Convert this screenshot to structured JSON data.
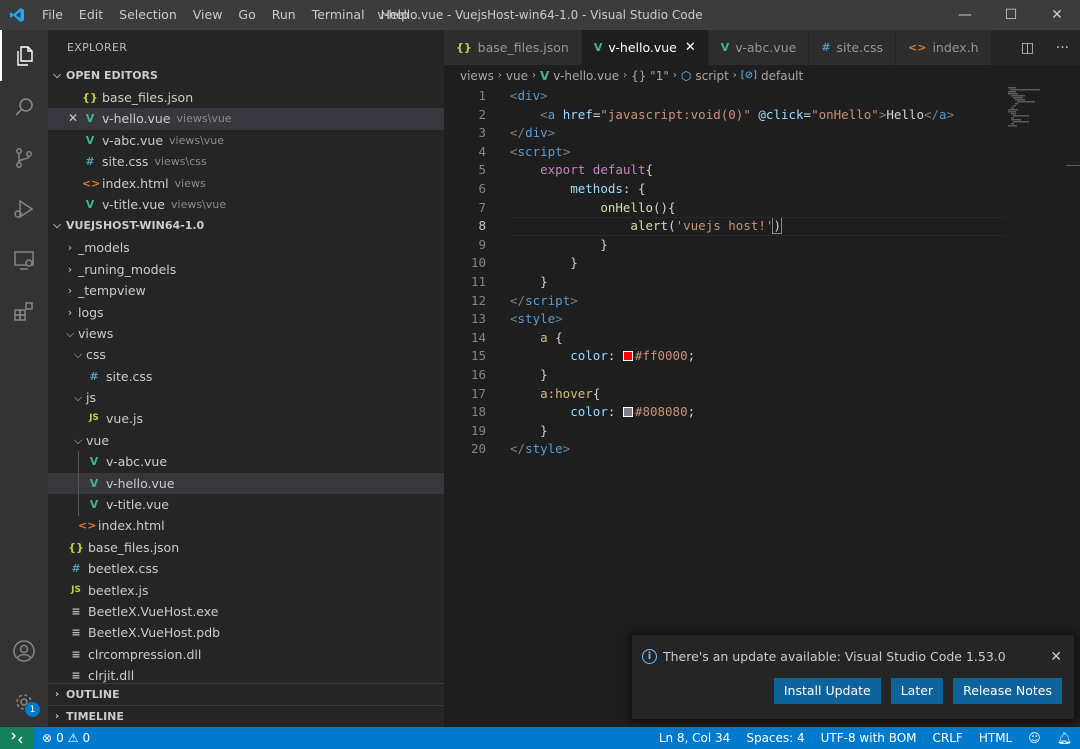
{
  "window": {
    "title": "v-hello.vue - VuejsHost-win64-1.0 - Visual Studio Code",
    "menu": [
      "File",
      "Edit",
      "Selection",
      "View",
      "Go",
      "Run",
      "Terminal",
      "Help"
    ],
    "controls": {
      "minimize": "—",
      "maximize": "☐",
      "close": "✕"
    }
  },
  "activity_bar": {
    "items": [
      "files-icon",
      "search-icon",
      "source-control-icon",
      "run-debug-icon",
      "remote-explorer-icon",
      "extensions-icon"
    ],
    "bottom": [
      "account-icon",
      "manage-gear-icon"
    ],
    "manage_badge": "1"
  },
  "sidebar": {
    "header": "EXPLORER",
    "open_editors": {
      "title": "OPEN EDITORS",
      "items": [
        {
          "icon": "{}",
          "kind": "json",
          "name": "base_files.json",
          "desc": ""
        },
        {
          "icon": "V",
          "kind": "vue",
          "name": "v-hello.vue",
          "desc": "views\\vue",
          "selected": true
        },
        {
          "icon": "V",
          "kind": "vue",
          "name": "v-abc.vue",
          "desc": "views\\vue"
        },
        {
          "icon": "#",
          "kind": "css",
          "name": "site.css",
          "desc": "views\\css"
        },
        {
          "icon": "<>",
          "kind": "html",
          "name": "index.html",
          "desc": "views"
        },
        {
          "icon": "V",
          "kind": "vue",
          "name": "v-title.vue",
          "desc": "views\\vue"
        }
      ]
    },
    "project": {
      "title": "VUEJSHOST-WIN64-1.0",
      "tree": [
        {
          "depth": 0,
          "type": "folder",
          "open": false,
          "name": "_models"
        },
        {
          "depth": 0,
          "type": "folder",
          "open": false,
          "name": "_runing_models"
        },
        {
          "depth": 0,
          "type": "folder",
          "open": false,
          "name": "_tempview"
        },
        {
          "depth": 0,
          "type": "folder",
          "open": false,
          "name": "logs"
        },
        {
          "depth": 0,
          "type": "folder",
          "open": true,
          "name": "views"
        },
        {
          "depth": 1,
          "type": "folder",
          "open": true,
          "name": "css"
        },
        {
          "depth": 2,
          "type": "file",
          "icon": "#",
          "kind": "css",
          "name": "site.css"
        },
        {
          "depth": 1,
          "type": "folder",
          "open": true,
          "name": "js"
        },
        {
          "depth": 2,
          "type": "file",
          "icon": "JS",
          "kind": "js",
          "name": "vue.js"
        },
        {
          "depth": 1,
          "type": "folder",
          "open": true,
          "name": "vue"
        },
        {
          "depth": 2,
          "type": "file",
          "icon": "V",
          "kind": "vue",
          "name": "v-abc.vue"
        },
        {
          "depth": 2,
          "type": "file",
          "icon": "V",
          "kind": "vue",
          "name": "v-hello.vue",
          "selected": true
        },
        {
          "depth": 2,
          "type": "file",
          "icon": "V",
          "kind": "vue",
          "name": "v-title.vue"
        },
        {
          "depth": 1,
          "type": "file",
          "icon": "<>",
          "kind": "html",
          "name": "index.html"
        },
        {
          "depth": 0,
          "type": "file",
          "icon": "{}",
          "kind": "json",
          "name": "base_files.json"
        },
        {
          "depth": 0,
          "type": "file",
          "icon": "#",
          "kind": "css",
          "name": "beetlex.css"
        },
        {
          "depth": 0,
          "type": "file",
          "icon": "JS",
          "kind": "js",
          "name": "beetlex.js"
        },
        {
          "depth": 0,
          "type": "file",
          "icon": "≡",
          "kind": "file",
          "name": "BeetleX.VueHost.exe"
        },
        {
          "depth": 0,
          "type": "file",
          "icon": "≡",
          "kind": "file",
          "name": "BeetleX.VueHost.pdb"
        },
        {
          "depth": 0,
          "type": "file",
          "icon": "≡",
          "kind": "file",
          "name": "clrcompression.dll"
        },
        {
          "depth": 0,
          "type": "file",
          "icon": "≡",
          "kind": "file",
          "name": "clrjit.dll"
        }
      ]
    },
    "outline": "OUTLINE",
    "timeline": "TIMELINE"
  },
  "editor": {
    "tabs": [
      {
        "icon": "{}",
        "kind": "json",
        "label": "base_files.json"
      },
      {
        "icon": "V",
        "kind": "vue",
        "label": "v-hello.vue",
        "active": true
      },
      {
        "icon": "V",
        "kind": "vue",
        "label": "v-abc.vue"
      },
      {
        "icon": "#",
        "kind": "css",
        "label": "site.css"
      },
      {
        "icon": "<>",
        "kind": "html",
        "label": "index.h"
      }
    ],
    "breadcrumb": [
      "views",
      "vue",
      "v-hello.vue",
      "{} \"1\"",
      "script",
      "default"
    ],
    "current_line": 8,
    "lines": [
      [
        [
          "t-tag",
          "<"
        ],
        [
          "t-name",
          "div"
        ],
        [
          "t-tag",
          ">"
        ]
      ],
      [
        [
          "t-txt",
          "    "
        ],
        [
          "t-tag",
          "<"
        ],
        [
          "t-name",
          "a"
        ],
        [
          "t-txt",
          " "
        ],
        [
          "t-attr",
          "href"
        ],
        [
          "t-txt",
          "="
        ],
        [
          "t-str",
          "\"javascript:void(0)\""
        ],
        [
          "t-txt",
          " "
        ],
        [
          "t-attr",
          "@click"
        ],
        [
          "t-txt",
          "="
        ],
        [
          "t-str",
          "\"onHello\""
        ],
        [
          "t-tag",
          ">"
        ],
        [
          "t-txt",
          "Hello"
        ],
        [
          "t-tag",
          "</"
        ],
        [
          "t-name",
          "a"
        ],
        [
          "t-tag",
          ">"
        ]
      ],
      [
        [
          "t-tag",
          "</"
        ],
        [
          "t-name",
          "div"
        ],
        [
          "t-tag",
          ">"
        ]
      ],
      [
        [
          "t-tag",
          "<"
        ],
        [
          "t-name",
          "script"
        ],
        [
          "t-tag",
          ">"
        ]
      ],
      [
        [
          "t-txt",
          "    "
        ],
        [
          "t-kw",
          "export"
        ],
        [
          "t-txt",
          " "
        ],
        [
          "t-kw",
          "default"
        ],
        [
          "t-txt",
          "{"
        ]
      ],
      [
        [
          "t-txt",
          "        "
        ],
        [
          "t-prop",
          "methods"
        ],
        [
          "t-txt",
          ": {"
        ]
      ],
      [
        [
          "t-txt",
          "            "
        ],
        [
          "t-fn",
          "onHello"
        ],
        [
          "t-txt",
          "(){"
        ]
      ],
      [
        [
          "t-txt",
          "                "
        ],
        [
          "t-fn",
          "alert"
        ],
        [
          "t-txt",
          "("
        ],
        [
          "t-str",
          "'vuejs host!'"
        ],
        [
          "t-txt",
          ")"
        ]
      ],
      [
        [
          "t-txt",
          "            }"
        ]
      ],
      [
        [
          "t-txt",
          "        }"
        ]
      ],
      [
        [
          "t-txt",
          "    }"
        ]
      ],
      [
        [
          "t-tag",
          "</"
        ],
        [
          "t-name",
          "script"
        ],
        [
          "t-tag",
          ">"
        ]
      ],
      [
        [
          "t-tag",
          "<"
        ],
        [
          "t-name",
          "style"
        ],
        [
          "t-tag",
          ">"
        ]
      ],
      [
        [
          "t-txt",
          "    "
        ],
        [
          "t-sel",
          "a"
        ],
        [
          "t-txt",
          " {"
        ]
      ],
      [
        [
          "t-txt",
          "        "
        ],
        [
          "t-prop",
          "color"
        ],
        [
          "t-txt",
          ": "
        ],
        [
          "swatch",
          "#ff0000"
        ],
        [
          "t-str",
          "#ff0000"
        ],
        [
          "t-txt",
          ";"
        ]
      ],
      [
        [
          "t-txt",
          "    }"
        ]
      ],
      [
        [
          "t-txt",
          "    "
        ],
        [
          "t-sel",
          "a:hover"
        ],
        [
          "t-txt",
          "{"
        ]
      ],
      [
        [
          "t-txt",
          "        "
        ],
        [
          "t-prop",
          "color"
        ],
        [
          "t-txt",
          ": "
        ],
        [
          "swatch",
          "#808080"
        ],
        [
          "t-str",
          "#808080"
        ],
        [
          "t-txt",
          ";"
        ]
      ],
      [
        [
          "t-txt",
          "    }"
        ]
      ],
      [
        [
          "t-tag",
          "</"
        ],
        [
          "t-name",
          "style"
        ],
        [
          "t-tag",
          ">"
        ]
      ]
    ]
  },
  "notification": {
    "message": "There's an update available: Visual Studio Code 1.53.0",
    "buttons": [
      "Install Update",
      "Later",
      "Release Notes"
    ]
  },
  "status_bar": {
    "errors": "0",
    "warnings": "0",
    "position": "Ln 8, Col 34",
    "spaces": "Spaces: 4",
    "encoding": "UTF-8 with BOM",
    "eol": "CRLF",
    "language": "HTML"
  },
  "colors": {
    "accent": "#007acc",
    "vue": "#41b883",
    "json": "#cbcb41",
    "css": "#519aba",
    "html": "#e37933"
  }
}
